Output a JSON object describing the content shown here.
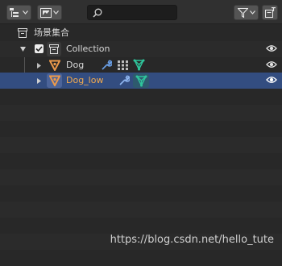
{
  "header": {
    "display_mode_icon": "outliner-display-mode-icon",
    "filter_dropdown_icon": "image-filter-icon",
    "search": {
      "value": "",
      "placeholder": ""
    },
    "filter_icon": "funnel-filter-icon",
    "new_collection_icon": "new-collection-icon"
  },
  "outliner": {
    "rows": [
      {
        "label": "场景集合",
        "type": "scene-collection"
      },
      {
        "label": "Collection",
        "type": "collection",
        "checked": true,
        "expanded": true
      },
      {
        "label": "Dog",
        "type": "object",
        "modifiers": [
          "wrench-icon",
          "grid-icon",
          "mesh-data-icon"
        ]
      },
      {
        "label": "Dog_low",
        "type": "object",
        "selected": true,
        "modifiers": [
          "wrench-icon",
          "mesh-data-icon"
        ]
      }
    ]
  },
  "colors": {
    "background": "#282828",
    "header": "#303030",
    "selected_row": "#334d80",
    "object_icon": "#ed9a4b",
    "modifier_icon": "#6a9fe6",
    "mesh_icon": "#2fc59c",
    "selected_label": "#f0a94e"
  },
  "watermark": "https://blog.csdn.net/hello_tute"
}
